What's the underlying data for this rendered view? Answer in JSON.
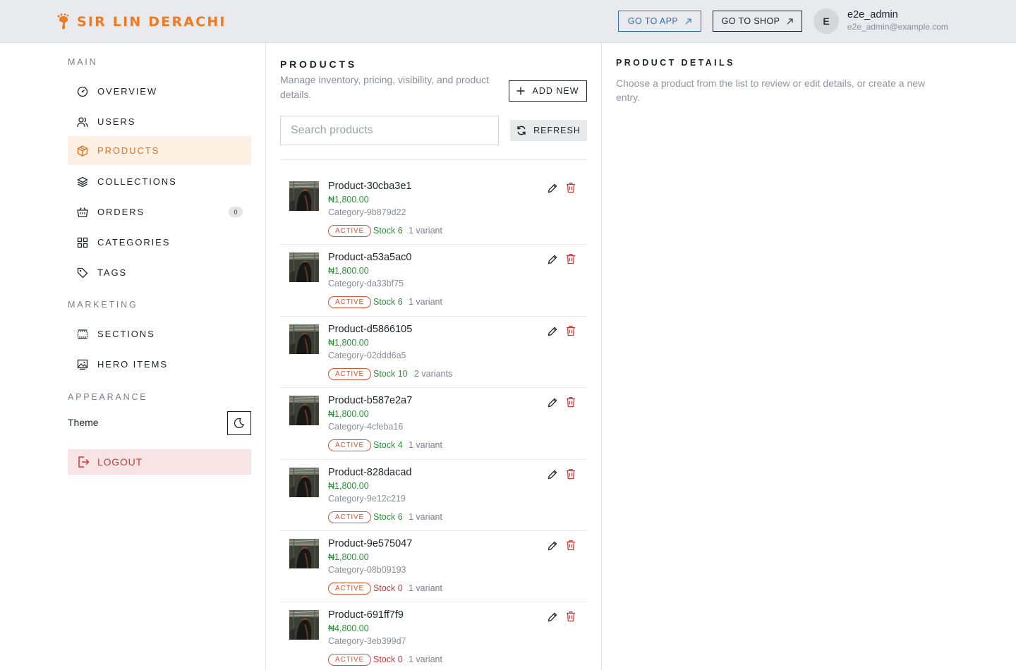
{
  "header": {
    "brand": "SIR LIN DERACHI",
    "go_to_app": "GO TO APP",
    "go_to_shop": "GO TO SHOP",
    "avatar_initial": "E",
    "user_name": "e2e_admin",
    "user_email": "e2e_admin@example.com"
  },
  "sidebar": {
    "main_title": "MAIN",
    "main_items": [
      {
        "label": "OVERVIEW",
        "icon": "gauge-icon"
      },
      {
        "label": "USERS",
        "icon": "users-icon"
      },
      {
        "label": "PRODUCTS",
        "icon": "box-icon",
        "active": true
      },
      {
        "label": "COLLECTIONS",
        "icon": "layers-icon"
      },
      {
        "label": "ORDERS",
        "icon": "basket-icon",
        "badge": "0"
      },
      {
        "label": "CATEGORIES",
        "icon": "grid-icon"
      },
      {
        "label": "TAGS",
        "icon": "tag-icon"
      }
    ],
    "marketing_title": "MARKETING",
    "marketing_items": [
      {
        "label": "SECTIONS",
        "icon": "sections-icon"
      },
      {
        "label": "HERO ITEMS",
        "icon": "image-icon"
      }
    ],
    "appearance_title": "APPEARANCE",
    "theme_label": "Theme",
    "logout_label": "LOGOUT"
  },
  "products": {
    "title": "PRODUCTS",
    "subtitle": "Manage inventory, pricing, visibility, and product details.",
    "add_new": "ADD NEW",
    "search_placeholder": "Search products",
    "refresh": "REFRESH",
    "items": [
      {
        "name": "Product-30cba3e1",
        "price": "₦1,800.00",
        "category": "Category-9b879d22",
        "status": "ACTIVE",
        "stock": "Stock 6",
        "variants": "1 variant"
      },
      {
        "name": "Product-a53a5ac0",
        "price": "₦1,800.00",
        "category": "Category-da33bf75",
        "status": "ACTIVE",
        "stock": "Stock 6",
        "variants": "1 variant"
      },
      {
        "name": "Product-d5866105",
        "price": "₦1,800.00",
        "category": "Category-02ddd6a5",
        "status": "ACTIVE",
        "stock": "Stock 10",
        "variants": "2 variants"
      },
      {
        "name": "Product-b587e2a7",
        "price": "₦1,800.00",
        "category": "Category-4cfeba16",
        "status": "ACTIVE",
        "stock": "Stock 4",
        "variants": "1 variant"
      },
      {
        "name": "Product-828dacad",
        "price": "₦1,800.00",
        "category": "Category-9e12c219",
        "status": "ACTIVE",
        "stock": "Stock 6",
        "variants": "1 variant"
      },
      {
        "name": "Product-9e575047",
        "price": "₦1,800.00",
        "category": "Category-08b09193",
        "status": "ACTIVE",
        "stock": "Stock 0",
        "variants": "1 variant"
      },
      {
        "name": "Product-691ff7f9",
        "price": "₦4,800.00",
        "category": "Category-3eb399d7",
        "status": "ACTIVE",
        "stock": "Stock 0",
        "variants": "1 variant"
      }
    ]
  },
  "details": {
    "title": "PRODUCT DETAILS",
    "text": "Choose a product from the list to review or edit details, or create a new entry."
  },
  "colors": {
    "brand": "#ee7a22",
    "in_stock": "#2f8f3b",
    "out_of_stock": "#c93a3a",
    "status": "#d9532c"
  }
}
